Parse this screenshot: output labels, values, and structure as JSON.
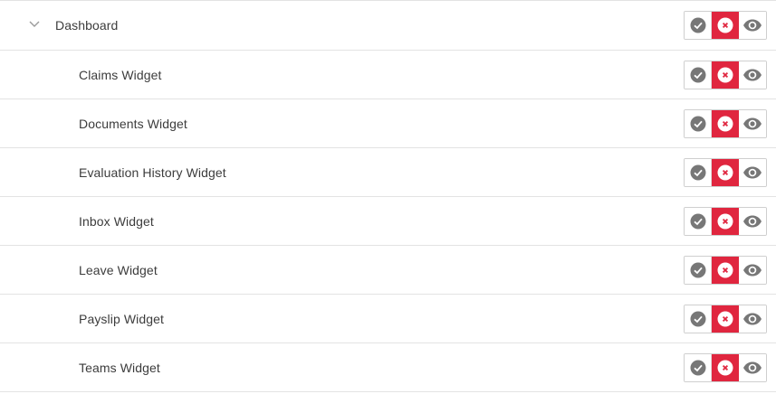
{
  "tree": {
    "parent": {
      "label": "Dashboard",
      "expanded": true,
      "permission_state": "deny"
    },
    "children": [
      {
        "label": "Claims Widget",
        "permission_state": "deny"
      },
      {
        "label": "Documents Widget",
        "permission_state": "deny"
      },
      {
        "label": "Evaluation History Widget",
        "permission_state": "deny"
      },
      {
        "label": "Inbox Widget",
        "permission_state": "deny"
      },
      {
        "label": "Leave Widget",
        "permission_state": "deny"
      },
      {
        "label": "Payslip Widget",
        "permission_state": "deny"
      },
      {
        "label": "Teams Widget",
        "permission_state": "deny"
      }
    ]
  },
  "icons": {
    "expand": "chevron-down-icon",
    "allow": "check-circle-icon",
    "deny": "close-circle-icon",
    "view": "eye-icon"
  },
  "colors": {
    "deny_active": "#e0263f",
    "icon_gray": "#777777",
    "text": "#3c3c3c",
    "divider": "#e3e3e3"
  }
}
